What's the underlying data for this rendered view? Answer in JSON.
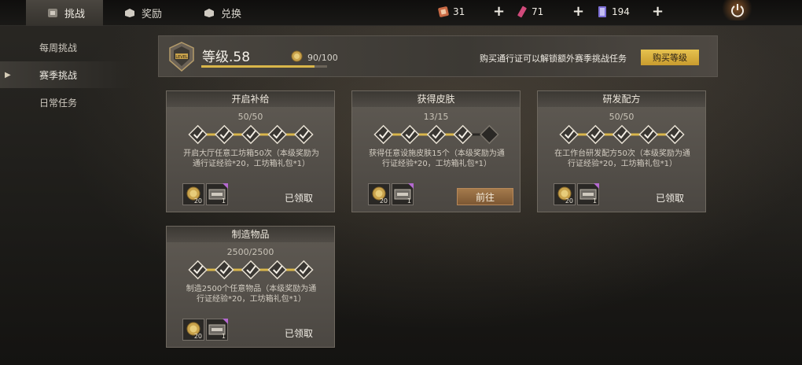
{
  "tabs": [
    {
      "label": "挑战",
      "icon": "challenge-icon",
      "active": true
    },
    {
      "label": "奖励",
      "icon": "reward-icon",
      "active": false
    },
    {
      "label": "兑换",
      "icon": "exchange-icon",
      "active": false
    }
  ],
  "resources": [
    {
      "icon": "ticket-icon",
      "value": "31",
      "color": "#c96a45"
    },
    {
      "icon": "crystal-icon",
      "value": "71",
      "color": "#d04a7a"
    },
    {
      "icon": "card-icon",
      "value": "194",
      "color": "#7d6fd6"
    }
  ],
  "plus_label": "+",
  "sidebar": {
    "items": [
      {
        "label": "每周挑战",
        "active": false
      },
      {
        "label": "赛季挑战",
        "active": true
      },
      {
        "label": "日常任务",
        "active": false
      }
    ]
  },
  "header": {
    "level_text": "等级.58",
    "emblem_text": "LEVEL",
    "xp_text": "90/100",
    "xp_progress": 0.9,
    "message": "购买通行证可以解锁额外赛季挑战任务",
    "buy_label": "购买等级",
    "accent": "#d9b64a"
  },
  "cards": [
    {
      "title": "开启补给",
      "progress": "50/50",
      "filled": 5,
      "total": 5,
      "desc": "开启大厅任意工坊箱50次（本级奖励为通行证经验*20，工坊箱礼包*1）",
      "rewards": [
        {
          "icon": "xp-coin-icon",
          "count": "20"
        },
        {
          "icon": "workshop-box-icon",
          "count": "1"
        }
      ],
      "status": "已领取",
      "action": "claimed"
    },
    {
      "title": "获得皮肤",
      "progress": "13/15",
      "filled": 4,
      "total": 5,
      "desc": "获得任意设施皮肤15个（本级奖励为通行证经验*20，工坊箱礼包*1）",
      "rewards": [
        {
          "icon": "xp-coin-icon",
          "count": "20"
        },
        {
          "icon": "workshop-box-icon",
          "count": "1"
        }
      ],
      "status": "前往",
      "action": "goto"
    },
    {
      "title": "研发配方",
      "progress": "50/50",
      "filled": 5,
      "total": 5,
      "desc": "在工作台研发配方50次（本级奖励为通行证经验*20，工坊箱礼包*1）",
      "rewards": [
        {
          "icon": "xp-coin-icon",
          "count": "20"
        },
        {
          "icon": "workshop-box-icon",
          "count": "1"
        }
      ],
      "status": "已领取",
      "action": "claimed"
    },
    {
      "title": "制造物品",
      "progress": "2500/2500",
      "filled": 5,
      "total": 5,
      "desc": "制造2500个任意物品（本级奖励为通行证经验*20，工坊箱礼包*1）",
      "rewards": [
        {
          "icon": "xp-coin-icon",
          "count": "20"
        },
        {
          "icon": "workshop-box-icon",
          "count": "1"
        }
      ],
      "status": "已领取",
      "action": "claimed"
    }
  ]
}
